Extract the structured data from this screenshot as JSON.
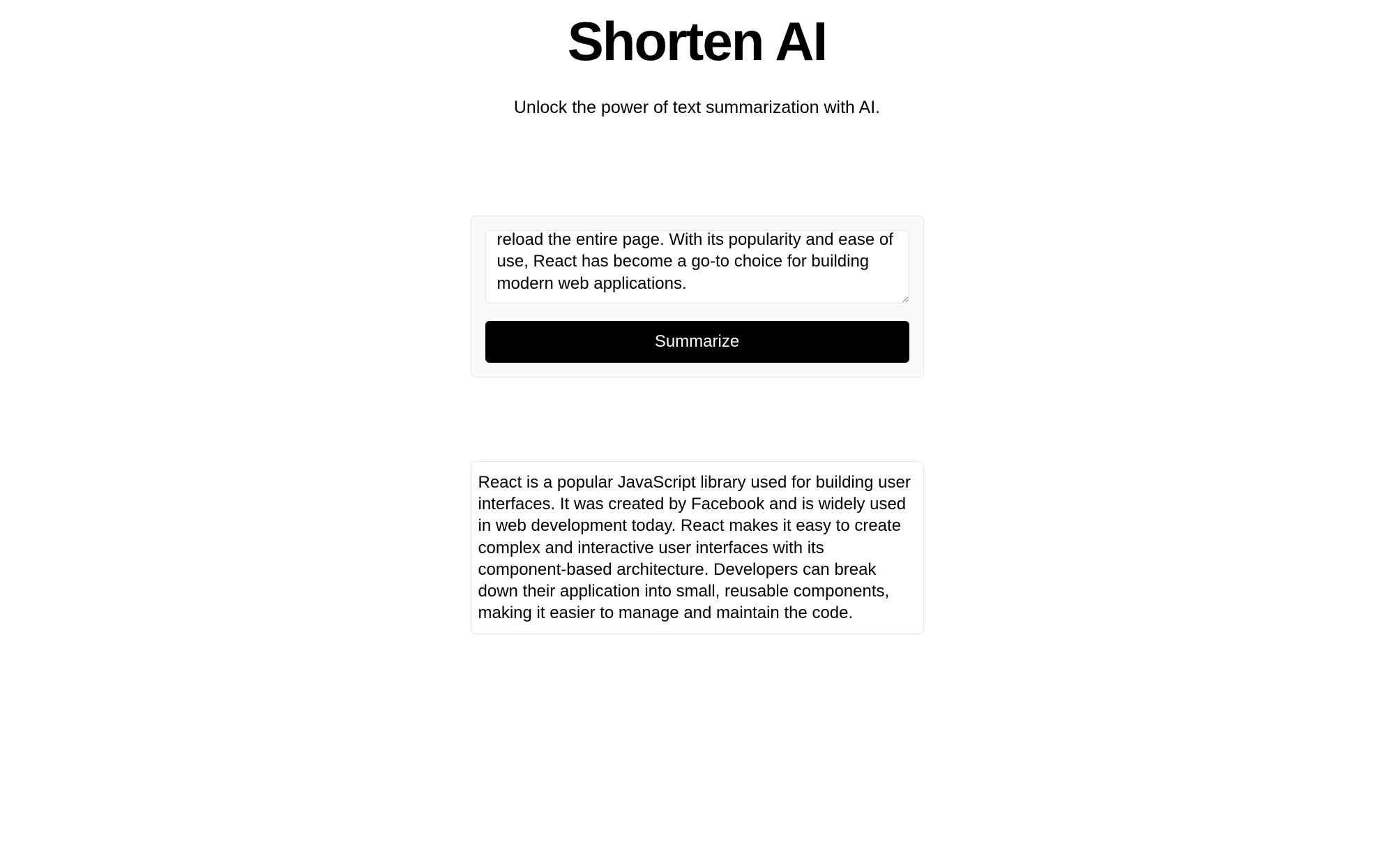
{
  "header": {
    "title": "Shorten AI",
    "subtitle": "Unlock the power of text summarization with AI."
  },
  "input": {
    "value": "React is a popular JavaScript library used for building user interfaces. It was created by Facebook and is widely used in web development today. React makes it easy to create complex and interactive user interfaces with its component-based architecture. Developers can break down their application into small, reusable components, making it easier to manage and maintain the code. React also offers a virtual DOM, which optimizes performance by only updating the parts of the DOM that have changed. This allows developers to quickly see the changes they make to their application, without having to reload the entire page. With its popularity and ease of use, React has become a go-to choice for building modern web applications."
  },
  "actions": {
    "summarize_label": "Summarize"
  },
  "output": {
    "text": "React is a popular JavaScript library used for building user interfaces. It was created by Facebook and is widely used in web development today. React makes it easy to create complex and interactive user interfaces with its component-based architecture. Developers can break down their application into small, reusable components, making it easier to manage and maintain the code."
  }
}
